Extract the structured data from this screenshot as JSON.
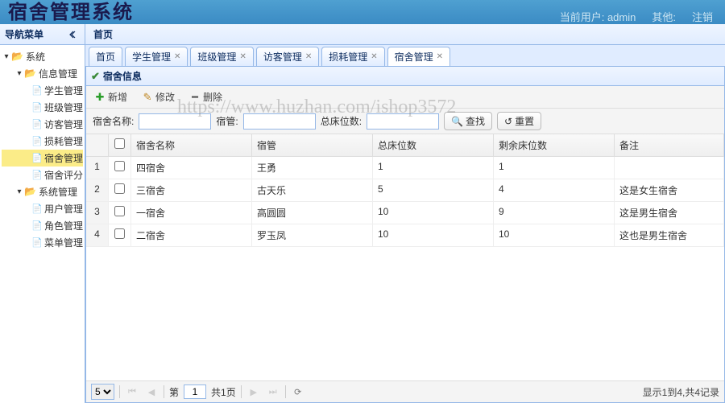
{
  "header": {
    "logo": "宿舍管理系统",
    "current_user_label": "当前用户:",
    "current_user": "admin",
    "other_label": "其他:",
    "logout": "注销"
  },
  "sidebar": {
    "title": "导航菜单",
    "nodes": [
      {
        "label": "系统",
        "icon": "folder-o",
        "indent": 0,
        "expanded": true
      },
      {
        "label": "信息管理",
        "icon": "folder-o",
        "indent": 1,
        "expanded": true
      },
      {
        "label": "学生管理",
        "icon": "page-i",
        "indent": 2
      },
      {
        "label": "班级管理",
        "icon": "page-i",
        "indent": 2
      },
      {
        "label": "访客管理",
        "icon": "page-i",
        "indent": 2
      },
      {
        "label": "损耗管理",
        "icon": "page-i",
        "indent": 2
      },
      {
        "label": "宿舍管理",
        "icon": "page-i",
        "indent": 2,
        "selected": true
      },
      {
        "label": "宿舍评分",
        "icon": "page-i",
        "indent": 2
      },
      {
        "label": "系统管理",
        "icon": "folder-o",
        "indent": 1,
        "expanded": true
      },
      {
        "label": "用户管理",
        "icon": "page-i",
        "indent": 2
      },
      {
        "label": "角色管理",
        "icon": "page-i",
        "indent": 2
      },
      {
        "label": "菜单管理",
        "icon": "page-i",
        "indent": 2
      }
    ]
  },
  "center": {
    "title": "首页"
  },
  "tabs": [
    {
      "label": "首页",
      "closable": false
    },
    {
      "label": "学生管理",
      "closable": true
    },
    {
      "label": "班级管理",
      "closable": true
    },
    {
      "label": "访客管理",
      "closable": true
    },
    {
      "label": "损耗管理",
      "closable": true
    },
    {
      "label": "宿舍管理",
      "closable": true,
      "active": true
    }
  ],
  "datagrid": {
    "title": "宿舍信息",
    "toolbar": {
      "add": "新增",
      "edit": "修改",
      "delete": "删除"
    },
    "search": {
      "name_label": "宿舍名称:",
      "keeper_label": "宿管:",
      "beds_label": "总床位数:",
      "find": "查找",
      "reset": "重置"
    },
    "columns": [
      "宿舍名称",
      "宿管",
      "总床位数",
      "剩余床位数",
      "备注"
    ],
    "rows": [
      {
        "n": "1",
        "name": "四宿舍",
        "keeper": "王勇",
        "total": "1",
        "remain": "1",
        "note": ""
      },
      {
        "n": "2",
        "name": "三宿舍",
        "keeper": "古天乐",
        "total": "5",
        "remain": "4",
        "note": "这是女生宿舍"
      },
      {
        "n": "3",
        "name": "一宿舍",
        "keeper": "高圆圆",
        "total": "10",
        "remain": "9",
        "note": "这是男生宿舍"
      },
      {
        "n": "4",
        "name": "二宿舍",
        "keeper": "罗玉凤",
        "total": "10",
        "remain": "10",
        "note": "这也是男生宿舍"
      }
    ],
    "pager": {
      "page_size": "5",
      "page_label_pre": "第",
      "page_current": "1",
      "page_total": "共1页",
      "info": "显示1到4,共4记录"
    }
  },
  "watermark": "https://www.huzhan.com/ishop3572"
}
